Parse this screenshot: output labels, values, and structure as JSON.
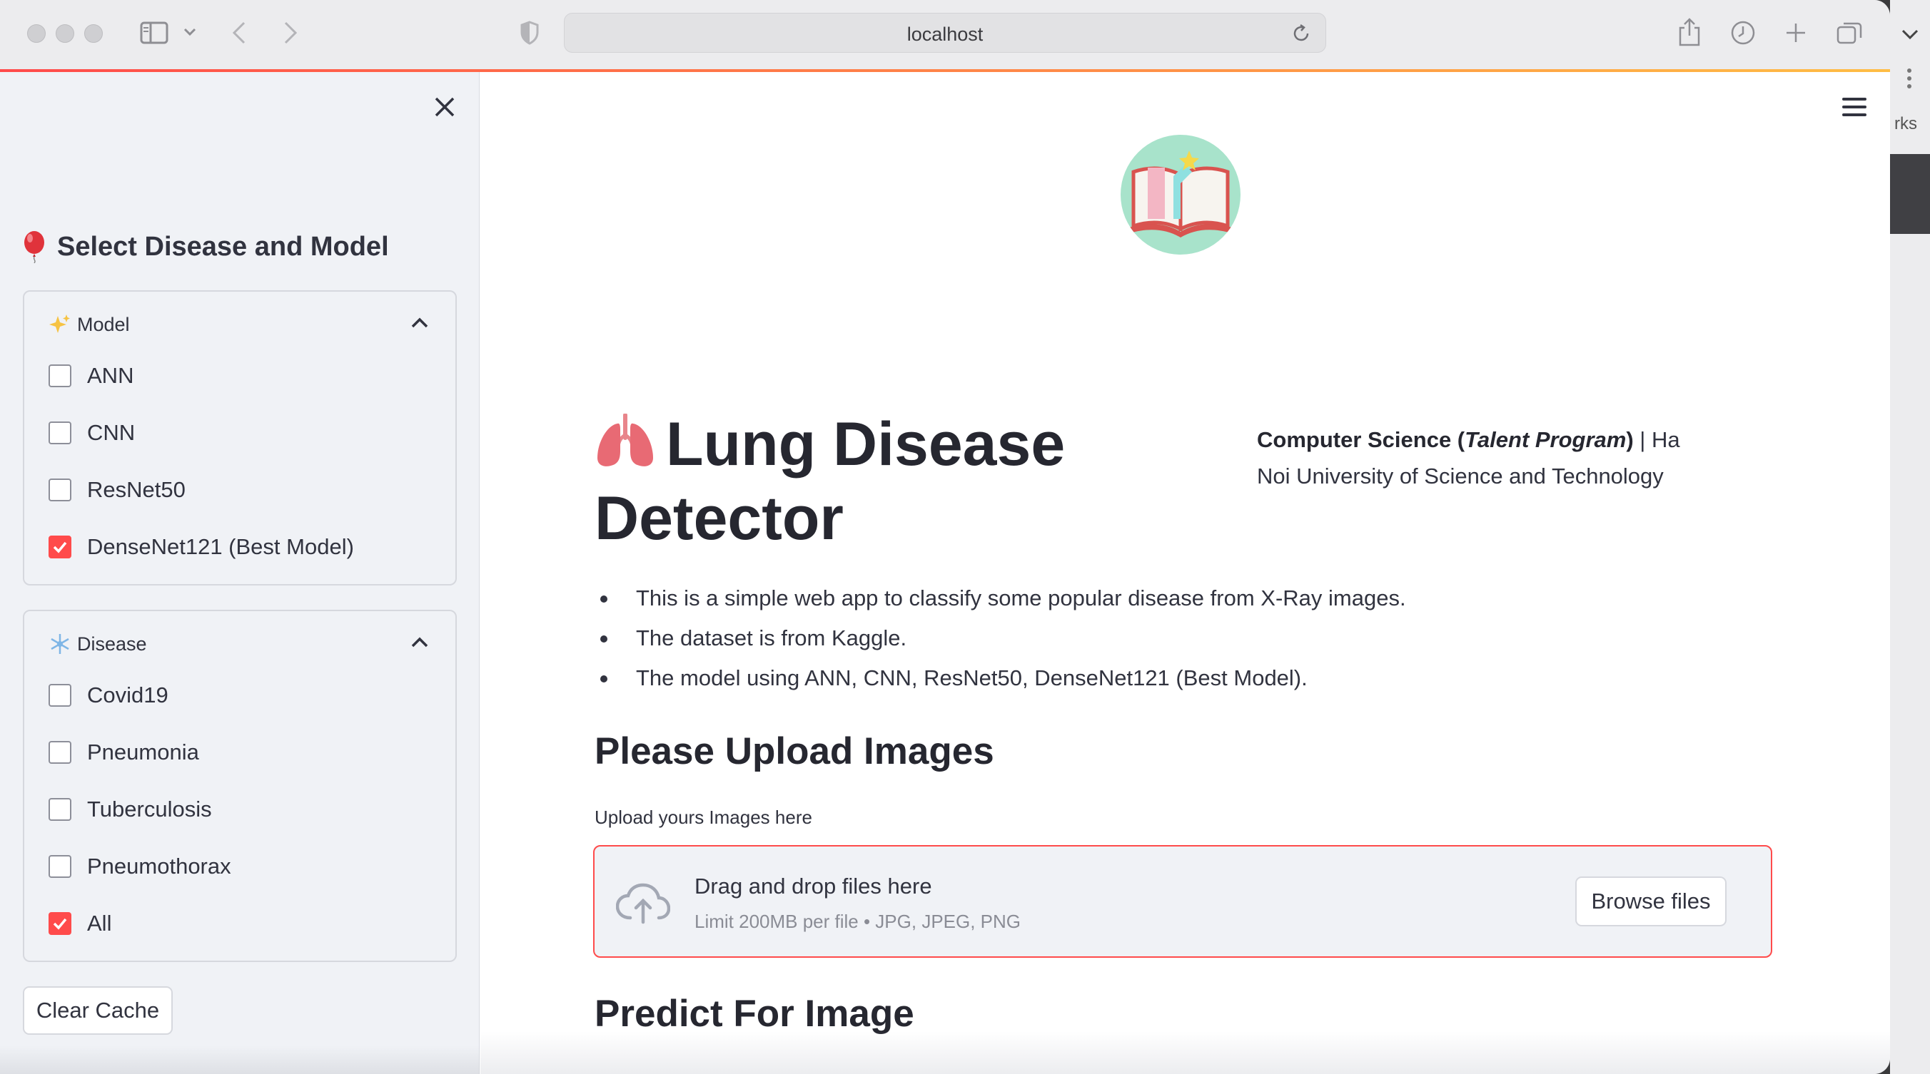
{
  "browser": {
    "url": "localhost",
    "peek_text": "rks"
  },
  "sidebar": {
    "title": "Select Disease and Model",
    "model_section": {
      "label": "Model",
      "options": [
        {
          "label": "ANN",
          "checked": false
        },
        {
          "label": "CNN",
          "checked": false
        },
        {
          "label": "ResNet50",
          "checked": false
        },
        {
          "label": "DenseNet121 (Best Model)",
          "checked": true
        }
      ]
    },
    "disease_section": {
      "label": "Disease",
      "options": [
        {
          "label": "Covid19",
          "checked": false
        },
        {
          "label": "Pneumonia",
          "checked": false
        },
        {
          "label": "Tuberculosis",
          "checked": false
        },
        {
          "label": "Pneumothorax",
          "checked": false
        },
        {
          "label": "All",
          "checked": true
        }
      ]
    },
    "clear_cache_label": "Clear Cache"
  },
  "main": {
    "title": "Lung Disease Detector",
    "credit": {
      "bold": "Computer Science (",
      "italic": "Talent Program",
      "bold_close": ")",
      "rest": " | Ha Noi University of Science and Technology"
    },
    "bullets": [
      "This is a simple web app to classify some popular disease from X-Ray images.",
      "The dataset is from Kaggle.",
      "The model using ANN, CNN, ResNet50, DenseNet121 (Best Model)."
    ],
    "upload_heading": "Please Upload Images",
    "upload_label": "Upload yours Images here",
    "dropzone": {
      "title": "Drag and drop files here",
      "subtitle": "Limit 200MB per file • JPG, JPEG, PNG",
      "browse_label": "Browse files"
    },
    "predict_heading": "Predict For Image"
  },
  "colors": {
    "accent": "#ff4b4b",
    "sidebar_bg": "#f0f2f6",
    "logo_bg": "#a8e3cb"
  }
}
